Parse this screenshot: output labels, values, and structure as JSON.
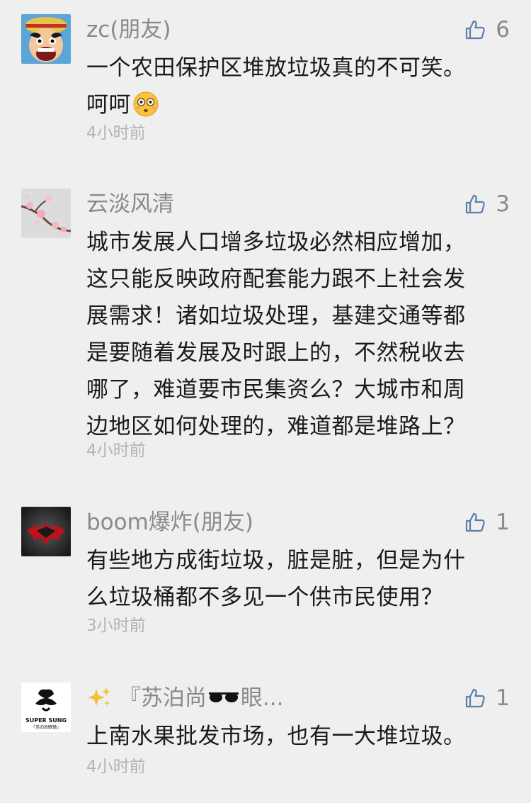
{
  "comments": [
    {
      "user": "zc(朋友)",
      "likes": "6",
      "lines": [
        "一个农田保护区堆放垃圾真的不可笑。",
        "呵呵"
      ],
      "time": "4小时前",
      "avatar_icon": "cartoon-luffy-avatar"
    },
    {
      "user": "云淡风清",
      "likes": "3",
      "lines": [
        "城市发展人口增多垃圾必然相应增加，",
        "这只能反映政府配套能力跟不上社会发",
        "展需求！诸如垃圾处理，基建交通等都",
        "是要随着发展及时跟上的，不然税收去",
        "哪了，难道要市民集资么？大城市和周",
        "边地区如何处理的，难道都是堆路上？"
      ],
      "time": "4小时前",
      "avatar_icon": "plum-blossom-avatar"
    },
    {
      "user": "boom爆炸(朋友)",
      "likes": "1",
      "lines": [
        "有些地方成街垃圾，脏是脏，但是为什",
        "么垃圾桶都不多见一个供市民使用？"
      ],
      "time": "3小时前",
      "avatar_icon": "batman-superman-logo-avatar"
    },
    {
      "user": "『苏泊尚",
      "user_suffix": "眼...",
      "likes": "1",
      "lines": [
        "上南水果批发市场，也有一大堆垃圾。"
      ],
      "time": "4小时前",
      "avatar_icon": "super-sung-logo-avatar",
      "avatar_text": "SUPER SUNG",
      "avatar_subtext": "『苏泊尚眼镜』"
    }
  ],
  "colors": {
    "background": "#efefef",
    "name": "#8a8a8a",
    "text": "#1a1a1a",
    "time": "#b3b3b3",
    "like_icon": "#5a7fa8"
  }
}
